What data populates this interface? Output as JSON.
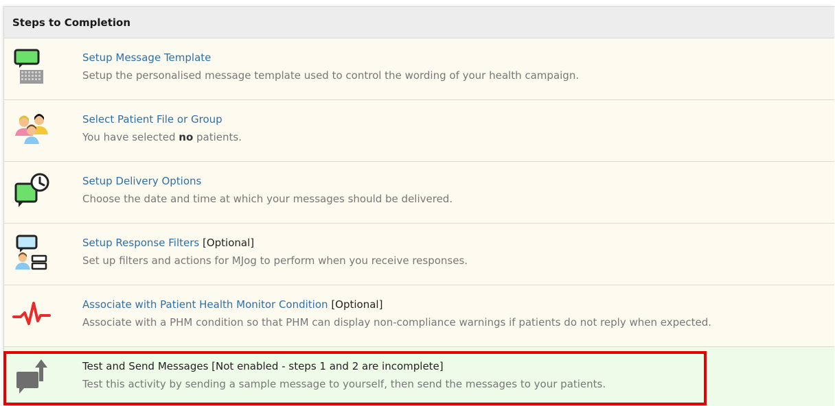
{
  "header": {
    "title": "Steps to Completion"
  },
  "steps": [
    {
      "title": "Setup Message Template",
      "extra": "",
      "description": "Setup the personalised message template used to control the wording of your health campaign.",
      "icon": "message-template-icon"
    },
    {
      "title": "Select Patient File or Group",
      "extra": "",
      "description_before": "You have selected ",
      "description_bold": "no",
      "description_after": " patients.",
      "icon": "patients-group-icon"
    },
    {
      "title": "Setup Delivery Options",
      "extra": "",
      "description": "Choose the date and time at which your messages should be delivered.",
      "icon": "delivery-clock-icon"
    },
    {
      "title": "Setup Response Filters",
      "extra": " [Optional]",
      "description": "Set up filters and actions for MJog to perform when you receive responses.",
      "icon": "response-filters-icon"
    },
    {
      "title": "Associate with Patient Health Monitor Condition",
      "extra": " [Optional]",
      "description": "Associate with a PHM condition so that PHM can display non-compliance warnings if patients do not reply when expected.",
      "icon": "heartbeat-icon"
    },
    {
      "title": "Test and Send Messages [Not enabled - steps 1 and 2 are incomplete]",
      "extra": "",
      "description": "Test this activity by sending a sample message to yourself, then send the messages to your patients.",
      "icon": "send-message-icon"
    }
  ],
  "colors": {
    "link": "#2f6fa8",
    "highlight": "#e60000",
    "step_bg": "#fdfbf0",
    "last_step_bg": "#eefbe8"
  }
}
